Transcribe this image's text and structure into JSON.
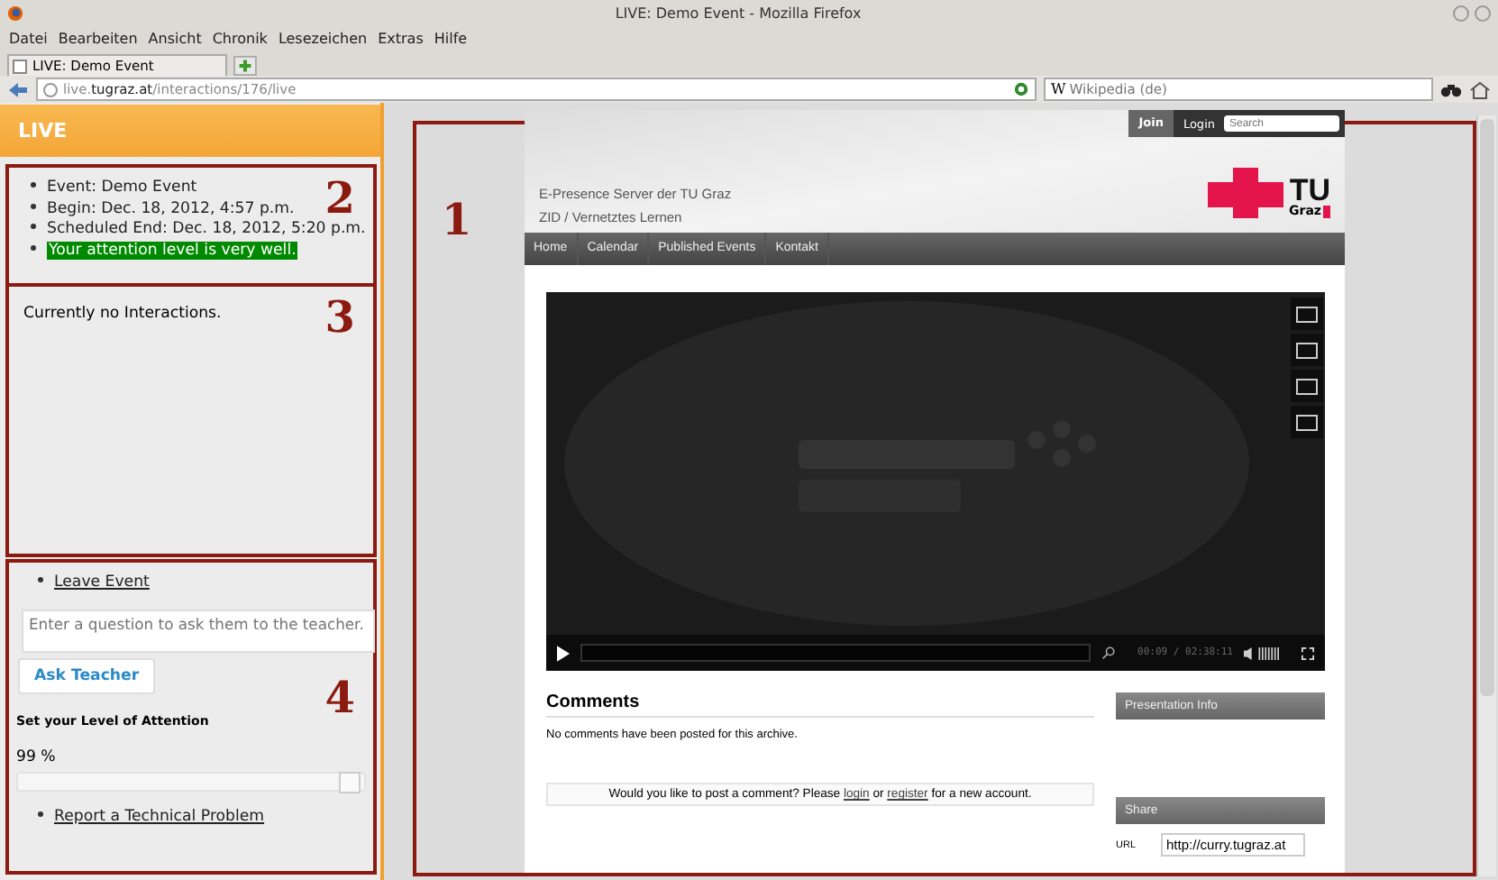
{
  "window": {
    "title": "LIVE: Demo Event - Mozilla Firefox"
  },
  "menu": [
    "Datei",
    "Bearbeiten",
    "Ansicht",
    "Chronik",
    "Lesezeichen",
    "Extras",
    "Hilfe"
  ],
  "tabs": [
    {
      "label": "LIVE: Demo Event",
      "selected": true
    }
  ],
  "address_bar": {
    "url": "live.**tugraz.at**/interactions/176/live"
  },
  "search_engine": {
    "logo": "W",
    "placeholder": "Wikipedia (de)"
  },
  "live_panel": {
    "title": "LIVE",
    "info": [
      "Event: Demo Event",
      "Begin: Dec. 18, 2012, 4:57 p.m.",
      "Scheduled End: Dec. 18, 2012, 5:20 p.m."
    ],
    "attention_status": "Your attention level is very well.",
    "info_annotation": "2",
    "interactions_text": "Currently no Interactions.",
    "interactions_annotation": "3",
    "controls_annotation": "4",
    "leave_link": "Leave Event",
    "question": {
      "placeholder": "Enter a question to ask them to the teacher."
    },
    "ask_button": "Ask Teacher",
    "attention_label": "Set your Level of Attention",
    "attention_reading": "99 %",
    "attention": {
      "level": 0.99
    },
    "report_link": "Report a Technical Problem"
  },
  "site": {
    "annotation": "1",
    "join": "Join",
    "login": "Login",
    "search": {
      "placeholder": "Search"
    },
    "title_lines": [
      "E-Presence Server der TU Graz",
      "ZID / Vernetztes Lernen"
    ],
    "logo": [
      "TU",
      "Graz"
    ],
    "nav": [
      "Home",
      "Calendar",
      "Published Events",
      "Kontakt"
    ],
    "player": {
      "time": "00:09 / 02:38:11"
    },
    "comments": {
      "title": "Comments",
      "empty": "No comments have been posted for this archive.",
      "prompt": [
        "Would you like to post a comment? Please ",
        "login",
        " or ",
        "register",
        " for a new account."
      ]
    },
    "sidebar": {
      "info_title": "Presentation Info",
      "share_title": "Share",
      "url_label": "URL",
      "url_value": "http://curry.tugraz.at"
    }
  }
}
